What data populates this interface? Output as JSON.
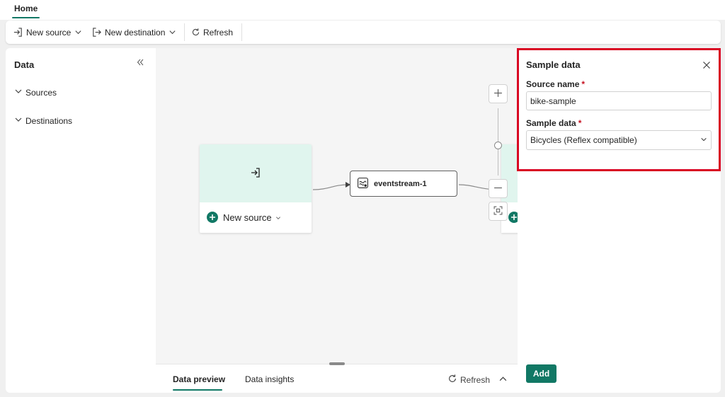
{
  "header": {
    "tab_home": "Home"
  },
  "toolbar": {
    "new_source": "New source",
    "new_destination": "New destination",
    "refresh": "Refresh"
  },
  "left_panel": {
    "title": "Data",
    "sections": [
      "Sources",
      "Destinations"
    ]
  },
  "canvas": {
    "source_card_label": "New source",
    "eventstream_name": "eventstream-1"
  },
  "bottom": {
    "tabs": [
      "Data preview",
      "Data insights"
    ],
    "refresh": "Refresh"
  },
  "right_panel": {
    "title": "Sample data",
    "source_name_label": "Source name",
    "source_name_value": "bike-sample",
    "sample_data_label": "Sample data",
    "sample_data_value": "Bicycles (Reflex compatible)",
    "required_marker": "*",
    "add_button": "Add"
  },
  "colors": {
    "accent": "#117865",
    "highlight_border": "#d90423",
    "required": "#c50f1f",
    "card_header": "#e0f5ee"
  },
  "icons": [
    "import-icon",
    "chevron-down-icon",
    "export-icon",
    "refresh-icon",
    "collapse-double-chevron-icon",
    "chevron-right-icon",
    "plus-icon",
    "minus-icon",
    "fit-view-icon",
    "eventstream-icon",
    "close-icon",
    "chevron-up-icon"
  ]
}
